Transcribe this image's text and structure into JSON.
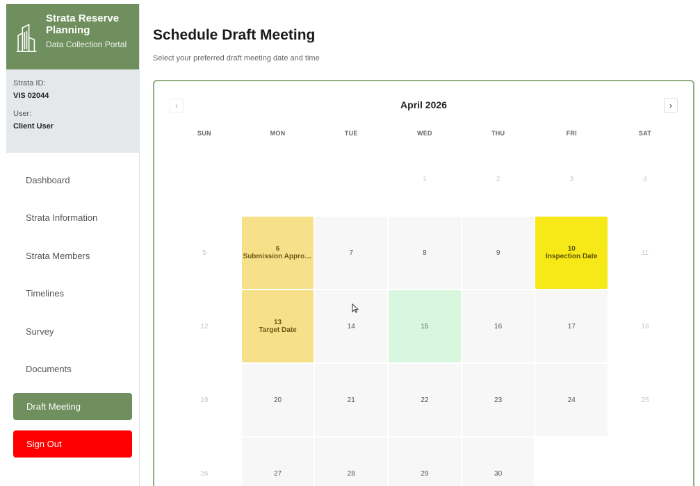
{
  "brand": {
    "title": "Strata Reserve Planning",
    "subtitle": "Data Collection Portal",
    "logo_icon": "buildings-icon"
  },
  "info": {
    "strata_id_label": "Strata ID:",
    "strata_id_value": "VIS 02044",
    "user_label": "User:",
    "user_value": "Client User"
  },
  "nav": {
    "items": [
      {
        "label": "Dashboard"
      },
      {
        "label": "Strata Information"
      },
      {
        "label": "Strata Members"
      },
      {
        "label": "Timelines"
      },
      {
        "label": "Survey"
      },
      {
        "label": "Documents"
      }
    ],
    "active_label": "Draft Meeting",
    "signout_label": "Sign Out"
  },
  "page": {
    "title": "Schedule Draft Meeting",
    "subtitle": "Select your preferred draft meeting date and time"
  },
  "calendar": {
    "month_label": "April 2026",
    "prev_glyph": "‹",
    "next_glyph": "›",
    "days_of_week": [
      "SUN",
      "MON",
      "TUE",
      "WED",
      "THU",
      "FRI",
      "SAT"
    ],
    "cells": [
      {
        "day": "",
        "type": "empty"
      },
      {
        "day": "",
        "type": "empty"
      },
      {
        "day": "",
        "type": "empty"
      },
      {
        "day": "1",
        "type": "muted"
      },
      {
        "day": "2",
        "type": "muted"
      },
      {
        "day": "3",
        "type": "muted"
      },
      {
        "day": "4",
        "type": "muted"
      },
      {
        "day": "5",
        "type": "muted"
      },
      {
        "day": "6",
        "type": "submission",
        "event": "Submission Approv..."
      },
      {
        "day": "7",
        "type": "weekday"
      },
      {
        "day": "8",
        "type": "weekday"
      },
      {
        "day": "9",
        "type": "weekday"
      },
      {
        "day": "10",
        "type": "inspection",
        "event": "Inspection Date"
      },
      {
        "day": "11",
        "type": "muted"
      },
      {
        "day": "12",
        "type": "muted"
      },
      {
        "day": "13",
        "type": "target",
        "event": "Target Date"
      },
      {
        "day": "14",
        "type": "weekday"
      },
      {
        "day": "15",
        "type": "selected"
      },
      {
        "day": "16",
        "type": "weekday"
      },
      {
        "day": "17",
        "type": "weekday"
      },
      {
        "day": "18",
        "type": "muted"
      },
      {
        "day": "19",
        "type": "muted"
      },
      {
        "day": "20",
        "type": "weekday"
      },
      {
        "day": "21",
        "type": "weekday"
      },
      {
        "day": "22",
        "type": "weekday"
      },
      {
        "day": "23",
        "type": "weekday"
      },
      {
        "day": "24",
        "type": "weekday"
      },
      {
        "day": "25",
        "type": "muted"
      },
      {
        "day": "26",
        "type": "muted"
      },
      {
        "day": "27",
        "type": "weekday"
      },
      {
        "day": "28",
        "type": "weekday"
      },
      {
        "day": "29",
        "type": "weekday"
      },
      {
        "day": "30",
        "type": "weekday"
      },
      {
        "day": "",
        "type": "empty"
      },
      {
        "day": "",
        "type": "empty"
      }
    ]
  },
  "colors": {
    "brand_green": "#6f8f5e",
    "signout_red": "#ff0000",
    "event_yellow": "#f7e08a",
    "inspection_yellow": "#f7e818",
    "selected_green": "#d9f7df"
  }
}
